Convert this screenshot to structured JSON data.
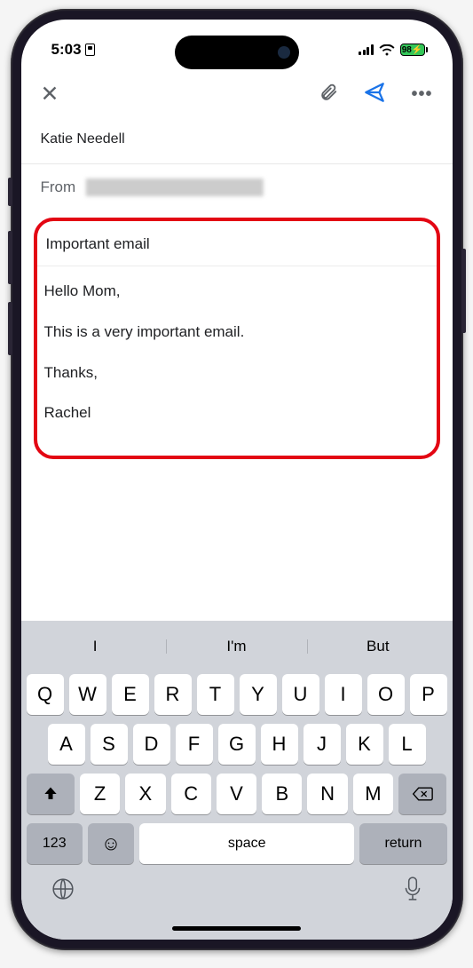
{
  "status": {
    "time": "5:03",
    "battery_pct": "98"
  },
  "compose": {
    "recipient": "Katie Needell",
    "from_label": "From",
    "subject": "Important email",
    "body_lines": [
      "Hello Mom,",
      "This is a very important email.",
      "Thanks,",
      "Rachel"
    ]
  },
  "keyboard": {
    "suggestions": [
      "I",
      "I'm",
      "But"
    ],
    "row1": [
      "Q",
      "W",
      "E",
      "R",
      "T",
      "Y",
      "U",
      "I",
      "O",
      "P"
    ],
    "row2": [
      "A",
      "S",
      "D",
      "F",
      "G",
      "H",
      "J",
      "K",
      "L"
    ],
    "row3": [
      "Z",
      "X",
      "C",
      "V",
      "B",
      "N",
      "M"
    ],
    "numkey": "123",
    "space": "space",
    "return": "return"
  }
}
